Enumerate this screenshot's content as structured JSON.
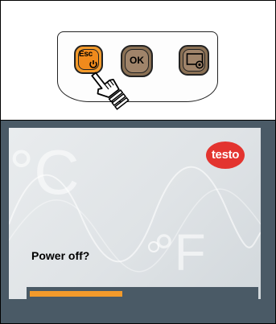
{
  "keypad": {
    "esc_label": "Esc",
    "ok_label": "OK",
    "icons": [
      "power-icon",
      "camera-icon",
      "pointer-hand-icon"
    ]
  },
  "screen": {
    "logo_text": "testo",
    "bg_celsius": "°C",
    "bg_fahrenheit": "°F",
    "prompt": "Power off?",
    "progress_fraction": 0.41
  },
  "colors": {
    "accent_orange": "#f39a2b",
    "logo_red": "#e3342f",
    "panel_slate": "#4a5a66"
  }
}
